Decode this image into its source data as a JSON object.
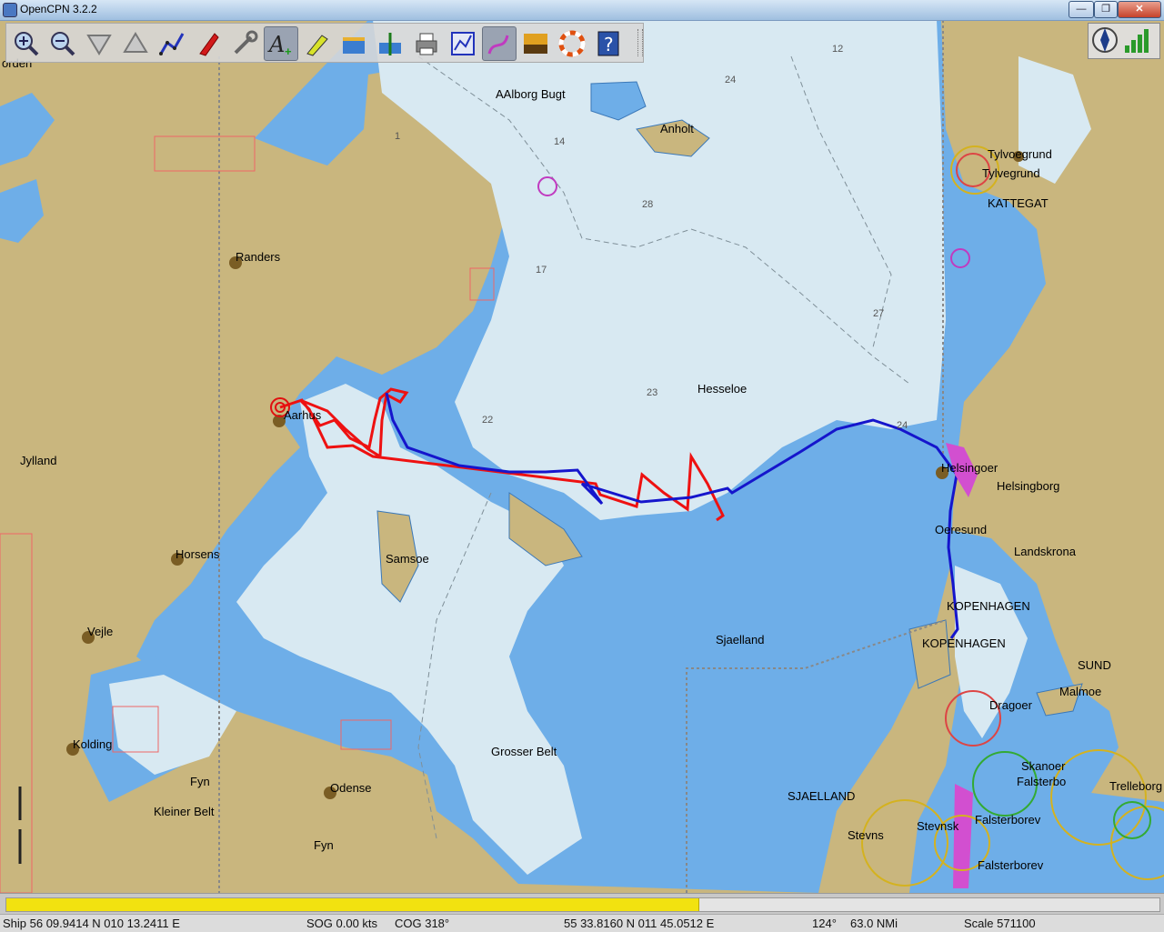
{
  "window": {
    "title": "OpenCPN 3.2.2",
    "minimize_glyph": "—",
    "restore_glyph": "❐",
    "close_glyph": "✕"
  },
  "toolbar": {
    "buttons": [
      {
        "icon": "zoom-in-icon"
      },
      {
        "icon": "zoom-out-icon"
      },
      {
        "icon": "scale-in-icon"
      },
      {
        "icon": "scale-out-icon"
      },
      {
        "icon": "route-icon"
      },
      {
        "icon": "follow-ship-icon"
      },
      {
        "icon": "settings-icon"
      },
      {
        "icon": "text-icon"
      },
      {
        "icon": "current-icon"
      },
      {
        "icon": "tide-icon"
      },
      {
        "icon": "gps-icon"
      },
      {
        "icon": "print-icon"
      },
      {
        "icon": "route-manager-icon"
      },
      {
        "icon": "track-icon"
      },
      {
        "icon": "color-scheme-icon"
      },
      {
        "icon": "mob-icon"
      },
      {
        "icon": "help-icon"
      }
    ],
    "active_index": [
      7,
      13
    ]
  },
  "labels": {
    "orden": "orden",
    "aalborg_bugt": "AAlborg Bugt",
    "anholt": "Anholt",
    "tylvoegrund": "Tylvoegrund",
    "tylvegrund": "Tylvegrund",
    "kattegat": "KATTEGAT",
    "randers": "Randers",
    "aarhus": "Aarhus",
    "jylland": "Jylland",
    "hesseloe": "Hesseloe",
    "helsingoer": "Helsingoer",
    "helsingborg": "Helsingborg",
    "oeresund": "Oeresund",
    "landskrona": "Landskrona",
    "horsens": "Horsens",
    "samsoe": "Samsoe",
    "kopenhagen1": "KOPENHAGEN",
    "kopenhagen2": "KOPENHAGEN",
    "sjaelland": "Sjaelland",
    "sund": "SUND",
    "malmoe": "Malmoe",
    "vejle": "Vejle",
    "dragoer": "Dragoer",
    "kolding": "Kolding",
    "grosser_belt": "Grosser Belt",
    "skanoer": "Skanoer",
    "falsterbo": "Falsterbo",
    "trelleborg": "Trelleborg",
    "fyn1": "Fyn",
    "odense": "Odense",
    "sjaelland_caps": "SJAELLAND",
    "kleiner_belt": "Kleiner Belt",
    "falsterborev1": "Falsterborev",
    "stevns": "Stevns",
    "stevnsk": "Stevnsk",
    "fyn2": "Fyn",
    "falsterborev2": "Falsterborev"
  },
  "depths": [
    "12",
    "24",
    "1",
    "14",
    "28",
    "17",
    "27",
    "22",
    "23",
    "24"
  ],
  "progress": {
    "fraction": 0.6
  },
  "status": {
    "ship": "Ship 56 09.9414 N   010 13.2411 E",
    "sog": "SOG 0.00 kts",
    "cog": "COG 318°",
    "cursor": "55 33.8160 N    011 45.0512 E",
    "bearing": "124°",
    "distance": "63.0 NMi",
    "scale": "Scale 571100"
  },
  "colors": {
    "land": "#c9b67e",
    "shallow": "#6eaee8",
    "deep": "#d8e9f2",
    "track_red": "#ee1111",
    "route_blue": "#1515cc"
  }
}
